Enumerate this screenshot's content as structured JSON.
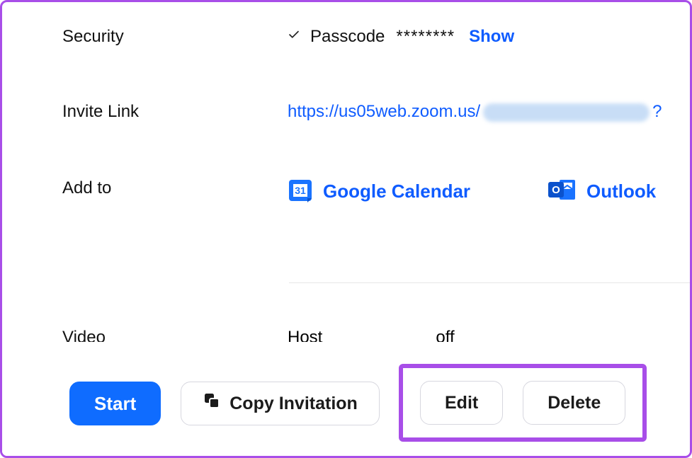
{
  "security": {
    "label": "Security",
    "passcode_label": "Passcode",
    "passcode_mask": "********",
    "show_label": "Show"
  },
  "invite": {
    "label": "Invite Link",
    "url_visible": "https://us05web.zoom.us/",
    "url_tail": "?"
  },
  "addto": {
    "label": "Add to",
    "google": "Google Calendar",
    "outlook": "Outlook"
  },
  "video": {
    "label": "Video",
    "host_label": "Host",
    "host_value": "off"
  },
  "footer": {
    "start": "Start",
    "copy": "Copy Invitation",
    "edit": "Edit",
    "delete": "Delete"
  },
  "colors": {
    "accent": "#0f6cff",
    "highlight_border": "#a84ee8"
  }
}
